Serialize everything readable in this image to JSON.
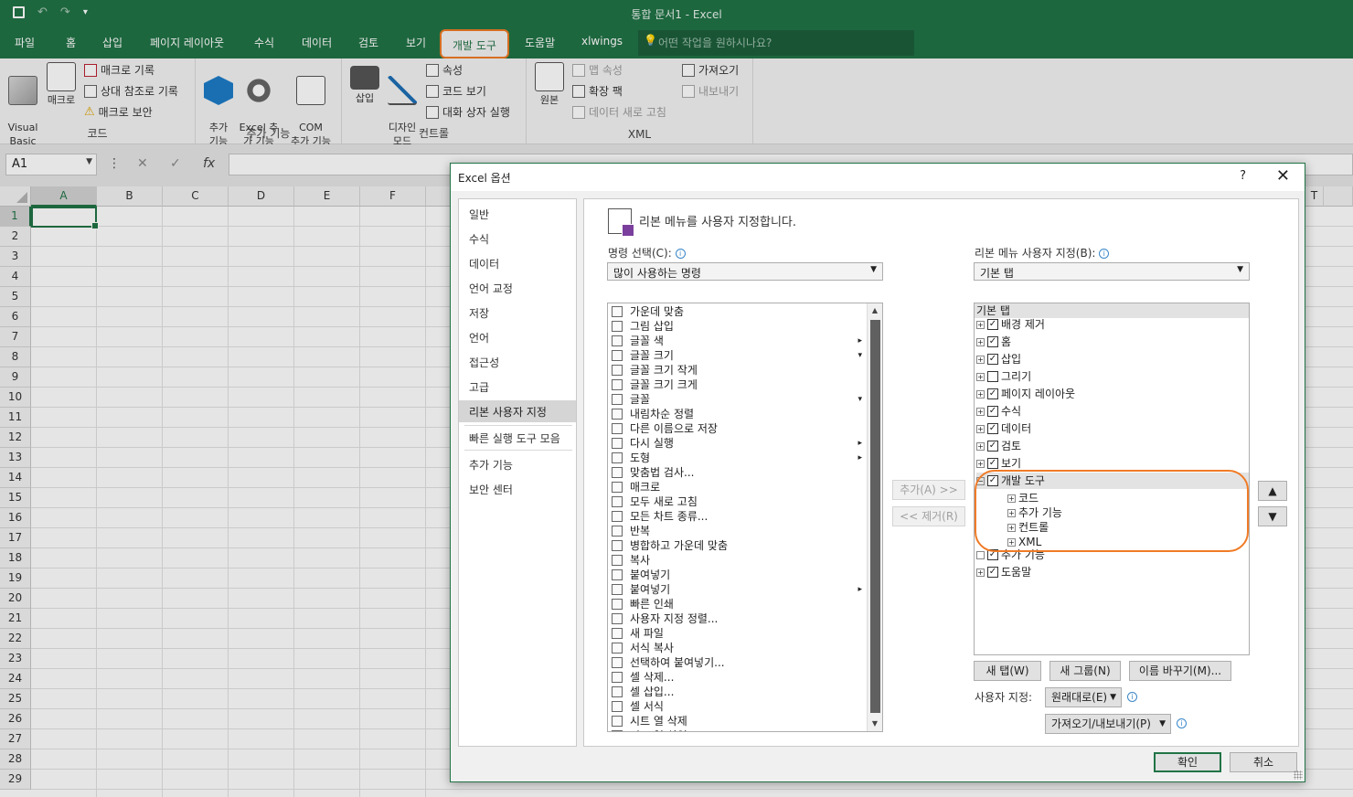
{
  "window": {
    "title": "통합 문서1  -  Excel"
  },
  "qat": {
    "save_icon": "save-icon",
    "undo": "↶",
    "redo": "↷",
    "more": "▾"
  },
  "tabs": [
    {
      "label": "파일"
    },
    {
      "label": "홈"
    },
    {
      "label": "삽입"
    },
    {
      "label": "페이지 레이아웃"
    },
    {
      "label": "수식"
    },
    {
      "label": "데이터"
    },
    {
      "label": "검토"
    },
    {
      "label": "보기"
    },
    {
      "label": "개발 도구"
    },
    {
      "label": "도움말"
    },
    {
      "label": "xlwings"
    }
  ],
  "tellme": {
    "placeholder": "어떤 작업을 원하시나요?"
  },
  "ribbon": {
    "code": {
      "label": "코드",
      "visual_basic": "Visual\nBasic",
      "macro": "매크로",
      "record": "매크로 기록",
      "relative": "상대 참조로 기록",
      "security": "매크로 보안"
    },
    "addins": {
      "label": "추가 기능",
      "addin": "추가\n기능",
      "excel_addin": "Excel 추\n가 기능",
      "com_addin": "COM\n추가 기능"
    },
    "controls": {
      "label": "컨트롤",
      "insert": "삽입",
      "design": "디자인\n모드",
      "properties": "속성",
      "view_code": "코드 보기",
      "run_dialog": "대화 상자 실행"
    },
    "xml": {
      "label": "XML",
      "source": "원본",
      "map_props": "맵 속성",
      "expansion": "확장 팩",
      "refresh": "데이터 새로 고침",
      "import": "가져오기",
      "export": "내보내기"
    }
  },
  "formula_bar": {
    "name_box": "A1",
    "cancel": "✕",
    "enter": "✓",
    "fx": "fx"
  },
  "grid": {
    "columns": [
      "A",
      "B",
      "C",
      "D",
      "E",
      "F"
    ],
    "far_column": "T",
    "rows": [
      "1",
      "2",
      "3",
      "4",
      "5",
      "6",
      "7",
      "8",
      "9",
      "10",
      "11",
      "12",
      "13",
      "14",
      "15",
      "16",
      "17",
      "18",
      "19",
      "20",
      "21",
      "22",
      "23",
      "24",
      "25",
      "26",
      "27",
      "28",
      "29"
    ]
  },
  "dialog": {
    "title": "Excel 옵션",
    "help": "?",
    "close": "✕",
    "nav": [
      "일반",
      "수식",
      "데이터",
      "언어 교정",
      "저장",
      "언어",
      "접근성",
      "고급",
      "리본 사용자 지정",
      "빠른 실행 도구 모음",
      "추가 기능",
      "보안 센터"
    ],
    "header": "리본 메뉴를 사용자 지정합니다.",
    "choose_label": "명령 선택(C):",
    "choose_value": "많이 사용하는 명령",
    "customize_label": "리본 메뉴 사용자 지정(B):",
    "customize_value": "기본 탭",
    "commands": [
      "가운데 맞춤",
      "그림 삽입",
      "글꼴 색",
      "글꼴 크기",
      "글꼴 크기 작게",
      "글꼴 크기 크게",
      "글꼴",
      "내림차순 정렬",
      "다른 이름으로 저장",
      "다시 실행",
      "도형",
      "맞춤법 검사...",
      "매크로",
      "모두 새로 고침",
      "모든 차트 종류...",
      "반복",
      "병합하고 가운데 맞춤",
      "복사",
      "붙여넣기",
      "붙여넣기",
      "빠른 인쇄",
      "사용자 지정 정렬...",
      "새 파일",
      "서식 복사",
      "선택하여 붙여넣기...",
      "셀 삭제...",
      "셀 삽입...",
      "셀 서식",
      "시트 열 삭제",
      "시트 열 삽입"
    ],
    "add_button": "추가(A) >>",
    "remove_button": "<< 제거(R)",
    "tree_head": "기본 탭",
    "tree": [
      {
        "label": "배경 제거",
        "checked": "✓"
      },
      {
        "label": "홈",
        "checked": "✓"
      },
      {
        "label": "삽입",
        "checked": "✓"
      },
      {
        "label": "그리기",
        "checked": ""
      },
      {
        "label": "페이지 레이아웃",
        "checked": "✓"
      },
      {
        "label": "수식",
        "checked": "✓"
      },
      {
        "label": "데이터",
        "checked": "✓"
      },
      {
        "label": "검토",
        "checked": "✓"
      },
      {
        "label": "보기",
        "checked": "✓"
      },
      {
        "label": "개발 도구",
        "checked": "✓"
      }
    ],
    "dev_children": [
      "코드",
      "추가 기능",
      "컨트롤",
      "XML"
    ],
    "tree_after": [
      {
        "label": "추가 기능",
        "checked": "✓"
      },
      {
        "label": "도움말",
        "checked": "✓"
      }
    ],
    "move_up": "▲",
    "move_down": "▼",
    "new_tab": "새 탭(W)",
    "new_group": "새 그룹(N)",
    "rename": "이름 바꾸기(M)...",
    "custom_label": "사용자 지정:",
    "reset_value": "원래대로(E)",
    "import_export": "가져오기/내보내기(P)",
    "ok": "확인",
    "cancel": "취소"
  },
  "colors": {
    "excel_green": "#217346",
    "highlight_orange": "#f07b26"
  }
}
